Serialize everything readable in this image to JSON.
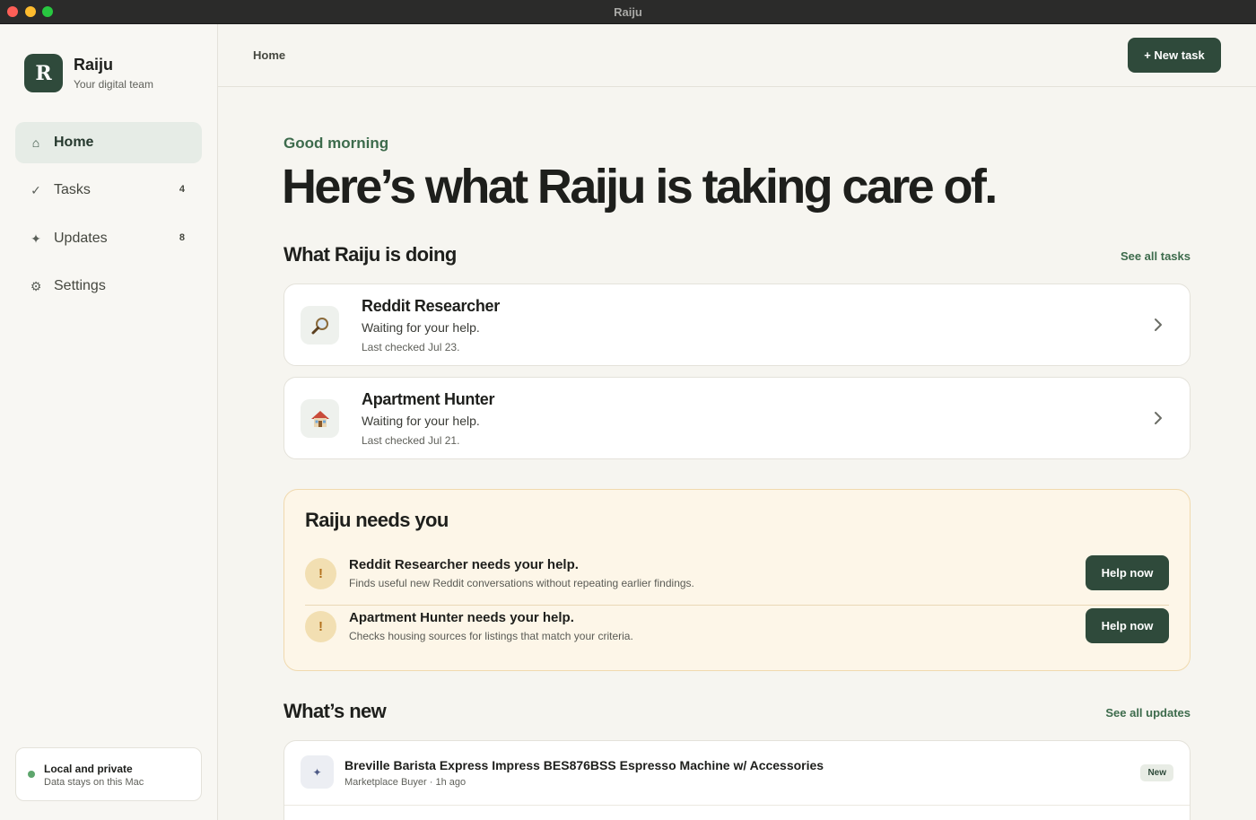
{
  "window": {
    "title": "Raiju"
  },
  "brand": {
    "logo_letter": "R",
    "name": "Raiju",
    "tagline": "Your digital team"
  },
  "sidebar": {
    "items": [
      {
        "label": "Home",
        "icon": "home-icon",
        "glyph": "⌂",
        "count": "",
        "active": true
      },
      {
        "label": "Tasks",
        "icon": "check-icon",
        "glyph": "✓",
        "count": "4",
        "active": false
      },
      {
        "label": "Updates",
        "icon": "sparkle-icon",
        "glyph": "✦",
        "count": "8",
        "active": false
      },
      {
        "label": "Settings",
        "icon": "gear-icon",
        "glyph": "⚙",
        "count": "",
        "active": false
      }
    ],
    "privacy": {
      "title": "Local and private",
      "subtitle": "Data stays on this Mac",
      "status_color": "#5ea66d"
    }
  },
  "header": {
    "breadcrumb": "Home",
    "new_task_label": "+ New task"
  },
  "hero": {
    "greeting": "Good morning",
    "headline": "Here’s what Raiju is taking care of."
  },
  "doing": {
    "title": "What Raiju is doing",
    "link": "See all tasks",
    "tasks": [
      {
        "name": "Reddit Researcher",
        "icon": "magnifier-icon",
        "status": "Waiting for your help.",
        "checked": "Last checked Jul 23."
      },
      {
        "name": "Apartment Hunter",
        "icon": "house-icon",
        "status": "Waiting for your help.",
        "checked": "Last checked Jul 21."
      }
    ]
  },
  "needs": {
    "title": "Raiju needs you",
    "items": [
      {
        "badge": "!",
        "title": "Reddit Researcher needs your help.",
        "description": "Finds useful new Reddit conversations without repeating earlier findings.",
        "button": "Help now"
      },
      {
        "badge": "!",
        "title": "Apartment Hunter needs your help.",
        "description": "Checks housing sources for listings that match your criteria.",
        "button": "Help now"
      }
    ]
  },
  "whats_new": {
    "title": "What’s new",
    "link": "See all updates",
    "items": [
      {
        "icon": "sparkle-icon",
        "glyph": "✦",
        "title": "Breville Barista Express Impress BES876BSS Espresso Machine w/ Accessories",
        "meta": "Marketplace Buyer · 1h ago",
        "badge": "New"
      }
    ]
  },
  "colors": {
    "accent": "#2f4a3b",
    "accent_text": "#3d6b4c",
    "warning_bg": "#fdf6e8",
    "warning_border": "#f0d9ae"
  }
}
